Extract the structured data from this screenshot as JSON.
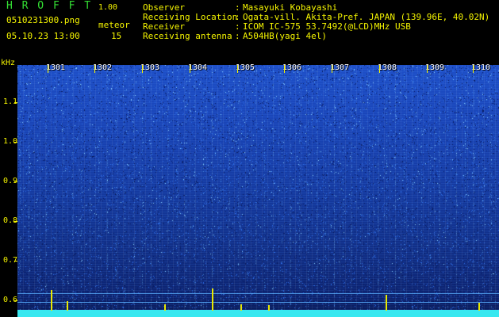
{
  "header": {
    "logo": "H R O F F T",
    "version": "1.00",
    "filename": "0510231300.png",
    "datetime": "05.10.23 13:00",
    "meteor_label": "meteor",
    "meteor_count": "15"
  },
  "info": [
    {
      "key": "Observer",
      "value": "Masayuki Kobayashi"
    },
    {
      "key": "Receiving Location",
      "value": "Ogata-vill. Akita-Pref. JAPAN (139.96E, 40.02N)"
    },
    {
      "key": "Receiver",
      "value": "ICOM IC-575 53.7492(@LCD)MHz USB"
    },
    {
      "key": "Receiving antenna",
      "value": "A504HB(yagi 4el)"
    }
  ],
  "colon": ":",
  "y_axis": {
    "unit": "kHz",
    "ticks": [
      "1.1",
      "1.0",
      "0.9",
      "0.8",
      "0.7",
      "0.6"
    ]
  },
  "time_labels": [
    "1301",
    "1302",
    "1303",
    "1304",
    "1305",
    "1306",
    "1307",
    "1308",
    "1309",
    "1310"
  ],
  "colors": {
    "label": "#f4f400",
    "logo": "#34e034",
    "spectrogram_high": "#1e4fc8",
    "spectrogram_low": "#0a1a55",
    "baseline": "#38e8f0",
    "spike": "#e8e800"
  }
}
